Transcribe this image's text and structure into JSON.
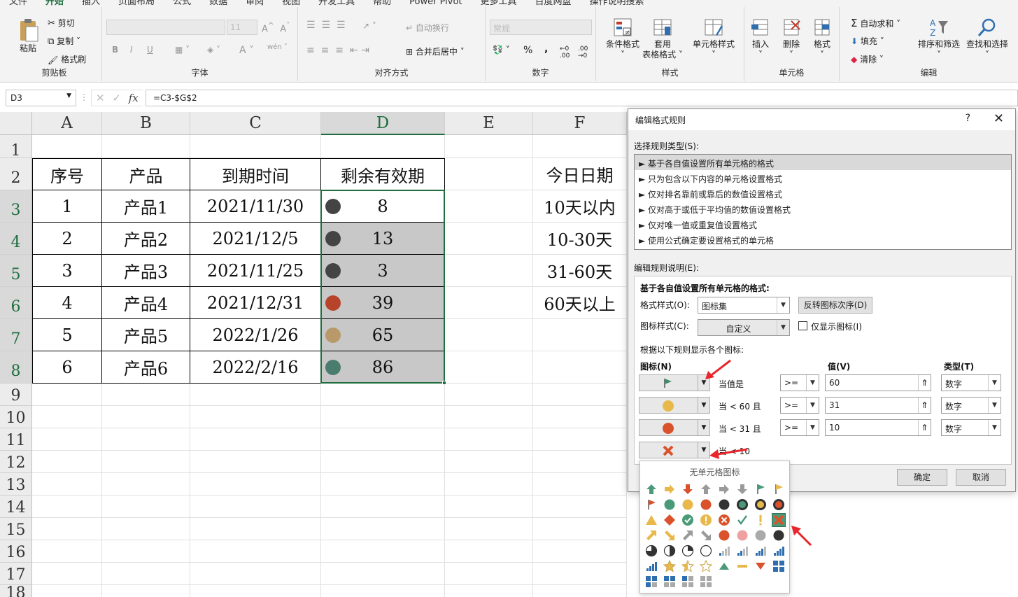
{
  "menu": {
    "tabs": [
      "文件",
      "开始",
      "插入",
      "页面布局",
      "公式",
      "数据",
      "审阅",
      "视图",
      "开发工具",
      "帮助",
      "Power Pivot",
      "更多工具",
      "百度网盘",
      "操作说明搜索"
    ],
    "active": "开始"
  },
  "ribbon": {
    "clipboard": {
      "title": "剪贴板",
      "paste": "粘贴",
      "cut": "剪切",
      "copy": "复制",
      "format_painter": "格式刷"
    },
    "font": {
      "title": "字体",
      "size": "11",
      "bold": "B",
      "italic": "I",
      "underline": "U"
    },
    "align": {
      "title": "对齐方式",
      "wrap": "自动换行",
      "merge": "合并后居中"
    },
    "number": {
      "title": "数字",
      "format": "常规",
      "percent": "%",
      "comma": ","
    },
    "styles": {
      "title": "样式",
      "conditional": "条件格式",
      "table_l1": "套用",
      "table_l2": "表格格式",
      "cell_styles": "单元格样式"
    },
    "cells": {
      "title": "单元格",
      "insert": "插入",
      "delete": "删除",
      "format": "格式"
    },
    "editing": {
      "title": "编辑",
      "autosum": "自动求和",
      "fill": "填充",
      "clear": "清除",
      "sort": "排序和筛选",
      "find": "查找和选择"
    }
  },
  "formula_bar": {
    "name_box": "D3",
    "formula": "=C3-$G$2",
    "fx": "fx"
  },
  "sheet": {
    "columns": [
      "A",
      "B",
      "C",
      "D",
      "E",
      "F"
    ],
    "rows": [
      "1",
      "2",
      "3",
      "4",
      "5",
      "6",
      "7",
      "8",
      "9",
      "10",
      "11",
      "12",
      "13",
      "14",
      "15",
      "16",
      "17",
      "18"
    ],
    "header": [
      "序号",
      "产品",
      "到期时间",
      "剩余有效期"
    ],
    "data": [
      {
        "no": "1",
        "product": "产品1",
        "date": "2021/11/30",
        "days": "8",
        "dot": "#444444"
      },
      {
        "no": "2",
        "product": "产品2",
        "date": "2021/12/5",
        "days": "13",
        "dot": "#444444"
      },
      {
        "no": "3",
        "product": "产品3",
        "date": "2021/11/25",
        "days": "3",
        "dot": "#444444"
      },
      {
        "no": "4",
        "product": "产品4",
        "date": "2021/12/31",
        "days": "39",
        "dot": "#b8432b"
      },
      {
        "no": "5",
        "product": "产品5",
        "date": "2022/1/26",
        "days": "65",
        "dot": "#b89a6a"
      },
      {
        "no": "6",
        "product": "产品6",
        "date": "2022/2/16",
        "days": "86",
        "dot": "#4a7d6e"
      }
    ],
    "f_header": "今日日期",
    "f_values": [
      "10天以内",
      "10-30天",
      "31-60天",
      "60天以上"
    ]
  },
  "dialog": {
    "title": "编辑格式规则",
    "help": "?",
    "close": "✕",
    "rule_type_label": "选择规则类型(S):",
    "rule_types": [
      "► 基于各自值设置所有单元格的格式",
      "► 只为包含以下内容的单元格设置格式",
      "► 仅对排名靠前或靠后的数值设置格式",
      "► 仅对高于或低于平均值的数值设置格式",
      "► 仅对唯一值或重复值设置格式",
      "► 使用公式确定要设置格式的单元格"
    ],
    "desc_label": "编辑规则说明(E):",
    "desc_title": "基于各自值设置所有单元格的格式:",
    "format_style_label": "格式样式(O):",
    "format_style": "图标集",
    "reverse": "反转图标次序(D)",
    "icon_style_label": "图标样式(C):",
    "icon_style": "自定义",
    "show_icon_only": "仅显示图标(I)",
    "rules_label": "根据以下规则显示各个图标:",
    "col_icon": "图标(N)",
    "col_value": "值(V)",
    "col_type": "类型(T)",
    "rules": [
      {
        "cond": "当值是",
        "op": ">=",
        "value": "60",
        "type": "数字"
      },
      {
        "cond": "当 < 60 且",
        "op": ">=",
        "value": "31",
        "type": "数字"
      },
      {
        "cond": "当 < 31 且",
        "op": ">=",
        "value": "10",
        "type": "数字"
      },
      {
        "cond": "当 < 10"
      }
    ],
    "ok": "确定",
    "cancel": "取消"
  },
  "icon_popup": {
    "title": "无单元格图标"
  },
  "colors": {
    "accent": "#1e6e3e",
    "green": "#4a9a7a",
    "yellow": "#e8b84a",
    "red": "#d9522c",
    "gray": "#8a8a8a",
    "blue": "#2f6fb0"
  }
}
